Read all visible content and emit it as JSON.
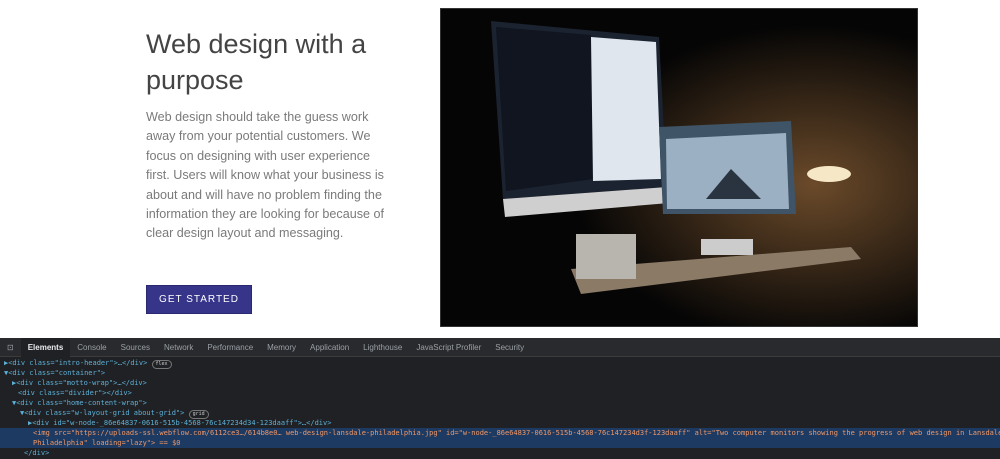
{
  "hero": {
    "title": "Web design with a purpose",
    "paragraph": "Web design should take the guess work away from your potential customers. We focus on designing with user experience first. Users will know what your business is about and will have no problem finding the information they are looking for because of clear design layout and messaging.",
    "button": "GET STARTED",
    "accent": "#37358a"
  },
  "devtools": {
    "tabs": [
      "Elements",
      "Console",
      "Sources",
      "Network",
      "Performance",
      "Memory",
      "Application",
      "Lighthouse",
      "JavaScript Profiler",
      "Security"
    ],
    "rows": [
      "▶<div class=\"intro-header\">…</div>",
      "▼<div class=\"container\">",
      "▶<div class=\"motto-wrap\">…</div>",
      "<div class=\"divider\"></div>",
      "▼<div class=\"home-content-wrap\">",
      "▼<div class=\"w-layout-grid about-grid\">",
      "▶<div id=\"w-node-_86e64837-0616-515b-4568-76c147234d34-123daaff\">…</div>"
    ],
    "badges": {
      "flex": "flex",
      "grid": "grid"
    },
    "selected_line1": "<img src=\"https://uploads-ssl.webflow.com/6112ce3…/614b8e0… web-design-lansdale-philadelphia.jpg\" id=\"w-node-_86e64837-0616-515b-4568-76c147234d3f-123daaff\" alt=\"Two computer monitors showing the progress of web design in Lansdale and",
    "selected_line2": "Philadelphia\" loading=\"lazy\"> == $0",
    "close_row": "</div>"
  }
}
